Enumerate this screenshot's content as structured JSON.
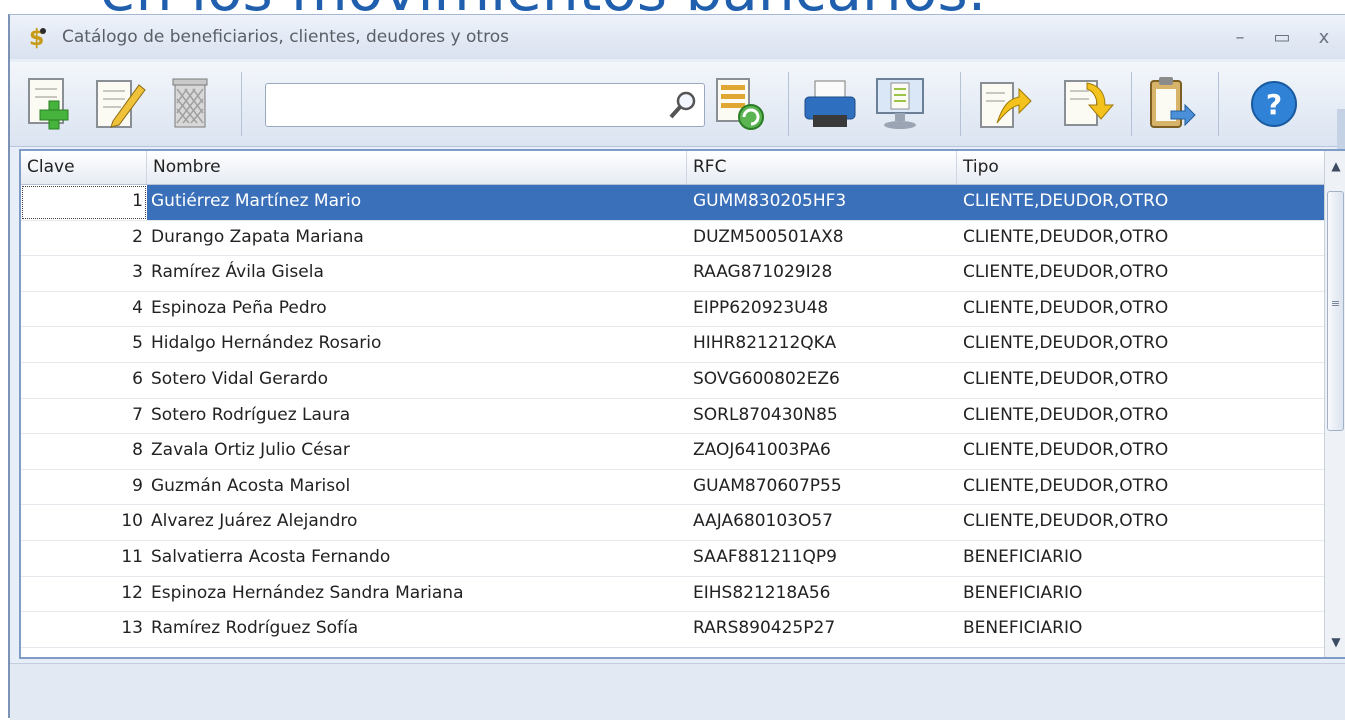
{
  "background_title": "en los movimientos bancarios.",
  "window": {
    "title": "Catálogo de beneficiarios, clientes, deudores y otros",
    "icon": "dollar-money-icon",
    "controls": {
      "minimize": "–",
      "maximize": "▭",
      "close": "x"
    }
  },
  "toolbar": {
    "search": {
      "value": "",
      "placeholder": ""
    },
    "buttons": [
      "add-document-icon",
      "edit-document-icon",
      "delete-trash-icon",
      "refresh-list-icon",
      "print-icon",
      "preview-monitor-icon",
      "export-document-icon",
      "import-document-icon",
      "paste-clipboard-icon",
      "help-icon"
    ],
    "help_symbol": "?"
  },
  "grid": {
    "columns": [
      "Clave",
      "Nombre",
      "RFC",
      "Tipo"
    ],
    "rows": [
      {
        "clave": "1",
        "nombre": "Gutiérrez Martínez Mario",
        "rfc": "GUMM830205HF3",
        "tipo": "CLIENTE,DEUDOR,OTRO"
      },
      {
        "clave": "2",
        "nombre": "Durango Zapata Mariana",
        "rfc": "DUZM500501AX8",
        "tipo": "CLIENTE,DEUDOR,OTRO"
      },
      {
        "clave": "3",
        "nombre": "Ramírez Ávila Gisela",
        "rfc": "RAAG871029I28",
        "tipo": "CLIENTE,DEUDOR,OTRO"
      },
      {
        "clave": "4",
        "nombre": "Espinoza Peña Pedro",
        "rfc": "EIPP620923U48",
        "tipo": "CLIENTE,DEUDOR,OTRO"
      },
      {
        "clave": "5",
        "nombre": "Hidalgo Hernández Rosario",
        "rfc": "HIHR821212QKA",
        "tipo": "CLIENTE,DEUDOR,OTRO"
      },
      {
        "clave": "6",
        "nombre": "Sotero Vidal Gerardo",
        "rfc": "SOVG600802EZ6",
        "tipo": "CLIENTE,DEUDOR,OTRO"
      },
      {
        "clave": "7",
        "nombre": "Sotero Rodríguez Laura",
        "rfc": "SORL870430N85",
        "tipo": "CLIENTE,DEUDOR,OTRO"
      },
      {
        "clave": "8",
        "nombre": "Zavala Ortiz Julio César",
        "rfc": "ZAOJ641003PA6",
        "tipo": "CLIENTE,DEUDOR,OTRO"
      },
      {
        "clave": "9",
        "nombre": "Guzmán Acosta Marisol",
        "rfc": "GUAM870607P55",
        "tipo": "CLIENTE,DEUDOR,OTRO"
      },
      {
        "clave": "10",
        "nombre": "Alvarez Juárez Alejandro",
        "rfc": "AAJA680103O57",
        "tipo": "CLIENTE,DEUDOR,OTRO"
      },
      {
        "clave": "11",
        "nombre": "Salvatierra Acosta Fernando",
        "rfc": "SAAF881211QP9",
        "tipo": "BENEFICIARIO"
      },
      {
        "clave": "12",
        "nombre": "Espinoza Hernández Sandra Mariana",
        "rfc": "EIHS821218A56",
        "tipo": "BENEFICIARIO"
      },
      {
        "clave": "13",
        "nombre": "Ramírez Rodríguez Sofía",
        "rfc": "RARS890425P27",
        "tipo": "BENEFICIARIO"
      }
    ],
    "selected_row": 0
  },
  "colors": {
    "selection": "#3a6fb9",
    "accent": "#1f5fae"
  }
}
